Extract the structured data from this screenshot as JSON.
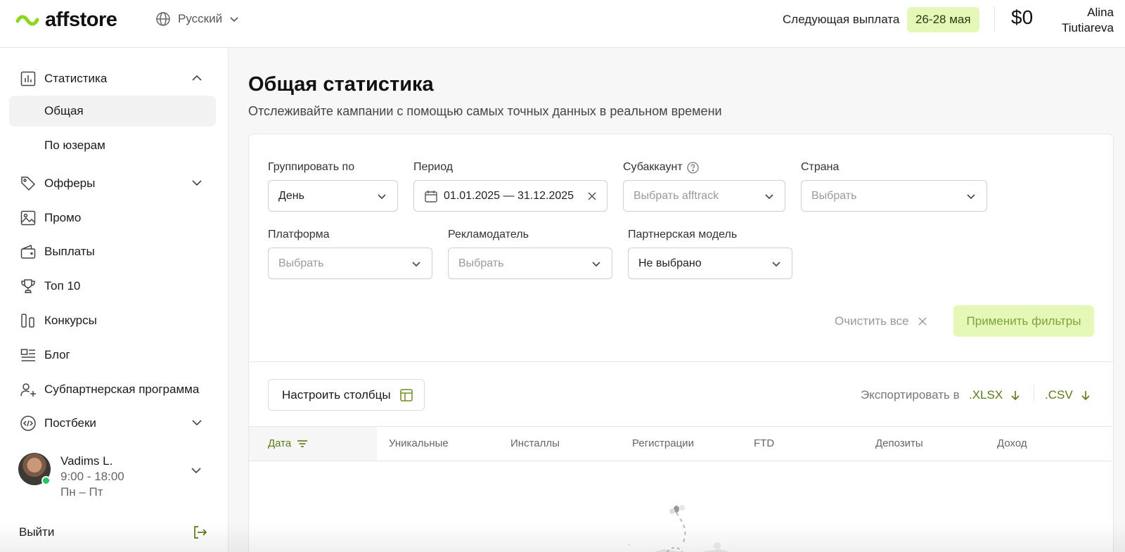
{
  "header": {
    "logo_text": "affstore",
    "language": "Русский",
    "next_payout_label": "Следующая выплата",
    "next_payout_dates": "26-28 мая",
    "balance": "$0",
    "user_first": "Alina",
    "user_last": "Tiutiareva"
  },
  "sidebar": {
    "items": [
      {
        "label": "Статистика",
        "icon": "bar-chart-icon"
      },
      {
        "label": "Офферы",
        "icon": "tag-icon"
      },
      {
        "label": "Промо",
        "icon": "image-icon"
      },
      {
        "label": "Выплаты",
        "icon": "wallet-icon"
      },
      {
        "label": "Топ 10",
        "icon": "trophy-icon"
      },
      {
        "label": "Конкурсы",
        "icon": "columns-icon"
      },
      {
        "label": "Блог",
        "icon": "blog-icon"
      },
      {
        "label": "Субпартнерская программа",
        "icon": "user-plus-icon"
      },
      {
        "label": "Постбеки",
        "icon": "code-icon"
      }
    ],
    "sub_items": [
      "Общая",
      "По юзерам"
    ],
    "manager": {
      "name": "Vadims L.",
      "hours": "9:00 - 18:00",
      "days": "Пн – Пт"
    },
    "logout": "Выйти"
  },
  "main": {
    "title": "Общая статистика",
    "subtitle": "Отслеживайте кампании с помощью самых точных данных в реальном времени"
  },
  "filters": {
    "group_by": {
      "label": "Группировать по",
      "value": "День"
    },
    "period": {
      "label": "Период",
      "value": "01.01.2025 — 31.12.2025"
    },
    "subaccount": {
      "label": "Субаккаунт",
      "placeholder": "Выбрать afftrack"
    },
    "country": {
      "label": "Страна",
      "placeholder": "Выбрать"
    },
    "platform": {
      "label": "Платформа",
      "placeholder": "Выбрать"
    },
    "advertiser": {
      "label": "Рекламодатель",
      "placeholder": "Выбрать"
    },
    "partner_model": {
      "label": "Партнерская модель",
      "value": "Не выбрано"
    },
    "clear_all": "Очистить все",
    "apply": "Применить фильтры"
  },
  "table_tools": {
    "columns_button": "Настроить столбцы",
    "export_label": "Экспортировать в",
    "export_xlsx": ".XLSX",
    "export_csv": ".CSV"
  },
  "table": {
    "headers": [
      "Дата",
      "Уникальные",
      "Инсталлы",
      "Регистрации",
      "FTD",
      "Депозиты",
      "Доход"
    ]
  },
  "colors": {
    "accent": "#e4f8b8",
    "link": "#5b7a1a",
    "logo_green": "#8bd61f"
  }
}
